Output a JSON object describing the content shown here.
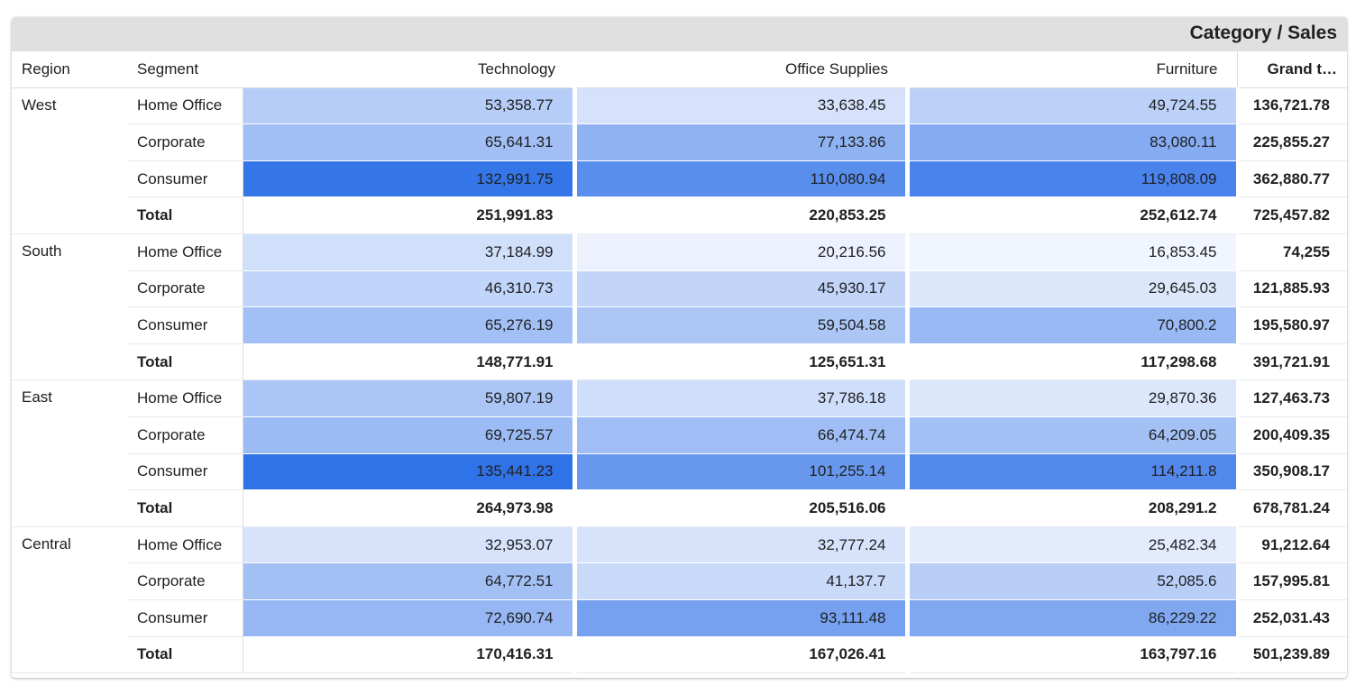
{
  "header": {
    "title": "Category / Sales"
  },
  "columns": {
    "region": "Region",
    "segment": "Segment",
    "technology": "Technology",
    "office_supplies": "Office Supplies",
    "furniture": "Furniture",
    "grand_total": "Grand t…"
  },
  "heat_scale": {
    "low": "#f1f5fe",
    "high": "#3072e8"
  },
  "rows": [
    {
      "region": "West",
      "segment": "Home Office",
      "tech": "53,358.77",
      "office": "33,638.45",
      "furn": "49,724.55",
      "grand": "136,721.78"
    },
    {
      "region": "",
      "segment": "Corporate",
      "tech": "65,641.31",
      "office": "77,133.86",
      "furn": "83,080.11",
      "grand": "225,855.27"
    },
    {
      "region": "",
      "segment": "Consumer",
      "tech": "132,991.75",
      "office": "110,080.94",
      "furn": "119,808.09",
      "grand": "362,880.77"
    },
    {
      "region": "",
      "segment": "Total",
      "tech": "251,991.83",
      "office": "220,853.25",
      "furn": "252,612.74",
      "grand": "725,457.82"
    },
    {
      "region": "South",
      "segment": "Home Office",
      "tech": "37,184.99",
      "office": "20,216.56",
      "furn": "16,853.45",
      "grand": "74,255"
    },
    {
      "region": "",
      "segment": "Corporate",
      "tech": "46,310.73",
      "office": "45,930.17",
      "furn": "29,645.03",
      "grand": "121,885.93"
    },
    {
      "region": "",
      "segment": "Consumer",
      "tech": "65,276.19",
      "office": "59,504.58",
      "furn": "70,800.2",
      "grand": "195,580.97"
    },
    {
      "region": "",
      "segment": "Total",
      "tech": "148,771.91",
      "office": "125,651.31",
      "furn": "117,298.68",
      "grand": "391,721.91"
    },
    {
      "region": "East",
      "segment": "Home Office",
      "tech": "59,807.19",
      "office": "37,786.18",
      "furn": "29,870.36",
      "grand": "127,463.73"
    },
    {
      "region": "",
      "segment": "Corporate",
      "tech": "69,725.57",
      "office": "66,474.74",
      "furn": "64,209.05",
      "grand": "200,409.35"
    },
    {
      "region": "",
      "segment": "Consumer",
      "tech": "135,441.23",
      "office": "101,255.14",
      "furn": "114,211.8",
      "grand": "350,908.17"
    },
    {
      "region": "",
      "segment": "Total",
      "tech": "264,973.98",
      "office": "205,516.06",
      "furn": "208,291.2",
      "grand": "678,781.24"
    },
    {
      "region": "Central",
      "segment": "Home Office",
      "tech": "32,953.07",
      "office": "32,777.24",
      "furn": "25,482.34",
      "grand": "91,212.64"
    },
    {
      "region": "",
      "segment": "Corporate",
      "tech": "64,772.51",
      "office": "41,137.7",
      "furn": "52,085.6",
      "grand": "157,995.81"
    },
    {
      "region": "",
      "segment": "Consumer",
      "tech": "72,690.74",
      "office": "93,111.48",
      "furn": "86,229.22",
      "grand": "252,031.43"
    },
    {
      "region": "",
      "segment": "Total",
      "tech": "170,416.31",
      "office": "167,026.41",
      "furn": "163,797.16",
      "grand": "501,239.89"
    }
  ]
}
